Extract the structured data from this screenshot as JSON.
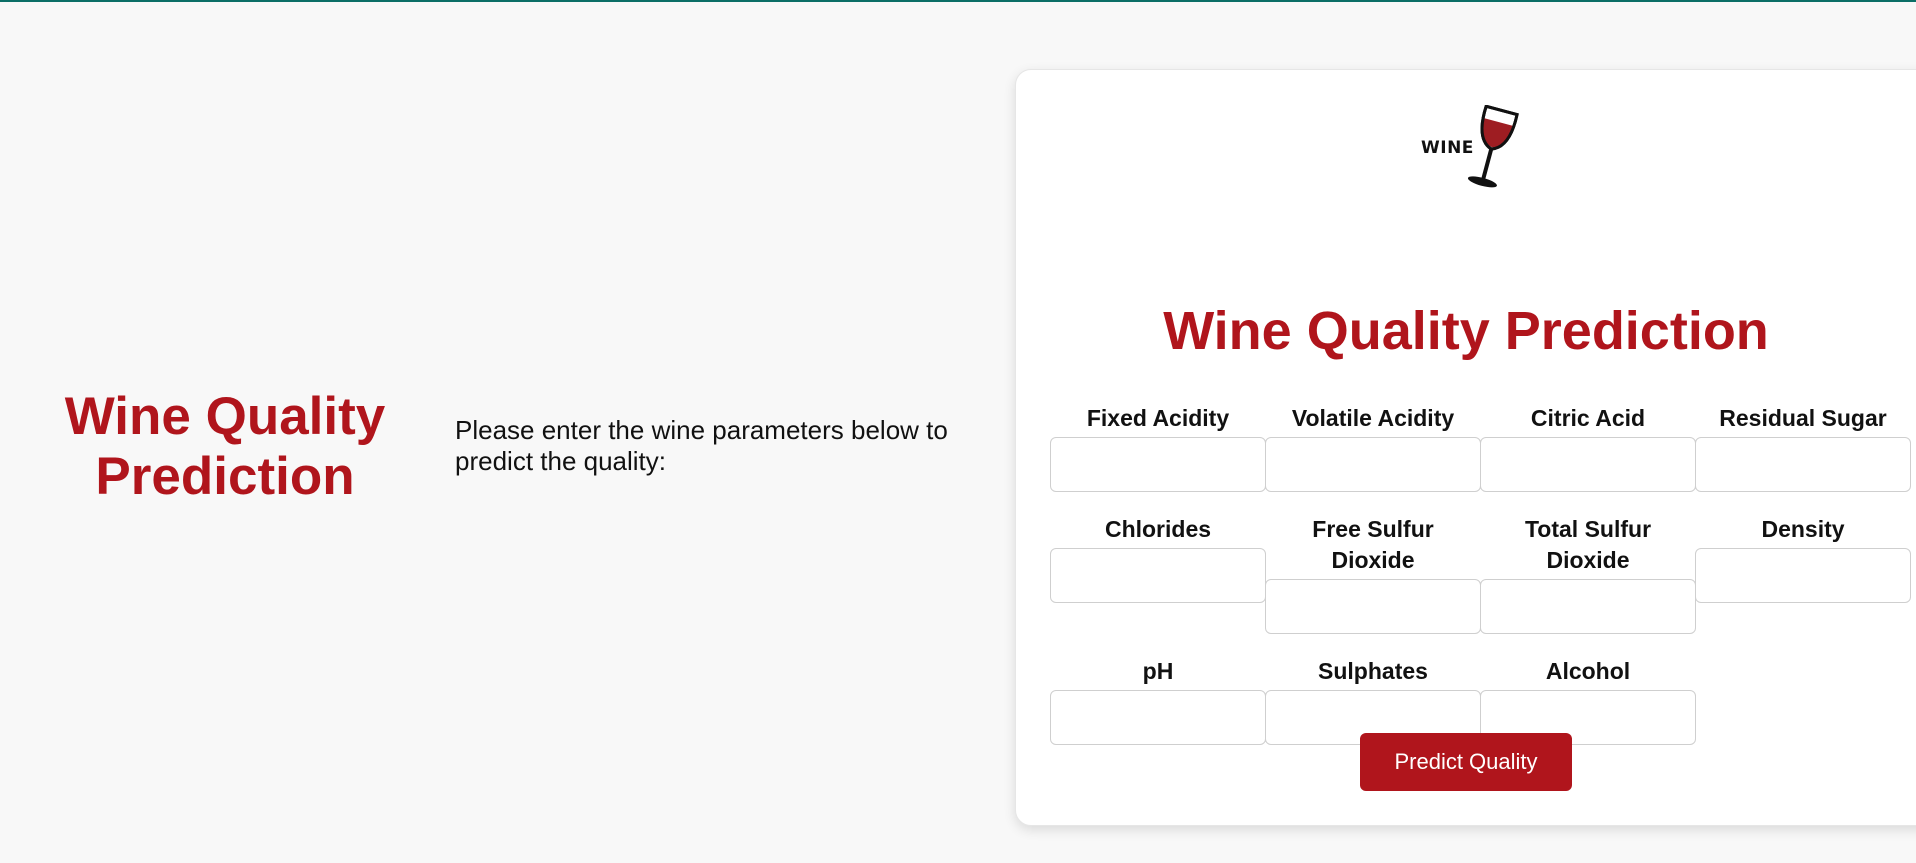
{
  "page": {
    "title": "Wine Quality Prediction",
    "intro": "Please enter the wine parameters below to predict the quality:"
  },
  "logo": {
    "text": "WINE"
  },
  "form": {
    "title": "Wine Quality Prediction",
    "fields": [
      {
        "label": "Fixed Acidity",
        "value": "",
        "placeholder": ""
      },
      {
        "label": "Volatile Acidity",
        "value": "",
        "placeholder": ""
      },
      {
        "label": "Citric Acid",
        "value": "",
        "placeholder": ""
      },
      {
        "label": "Residual Sugar",
        "value": "",
        "placeholder": ""
      },
      {
        "label": "Chlorides",
        "value": "",
        "placeholder": ""
      },
      {
        "label": "Free Sulfur Dioxide",
        "value": "",
        "placeholder": ""
      },
      {
        "label": "Total Sulfur Dioxide",
        "value": "",
        "placeholder": ""
      },
      {
        "label": "Density",
        "value": "",
        "placeholder": ""
      },
      {
        "label": "pH",
        "value": "",
        "placeholder": ""
      },
      {
        "label": "Sulphates",
        "value": "",
        "placeholder": ""
      },
      {
        "label": "Alcohol",
        "value": "",
        "placeholder": ""
      }
    ],
    "submit_label": "Predict Quality"
  },
  "colors": {
    "accent": "#b0151c",
    "top_border": "#0b6e66",
    "background": "#f8f8f8",
    "card": "#ffffff"
  },
  "icons": {
    "logo": "wine-glass-icon"
  }
}
